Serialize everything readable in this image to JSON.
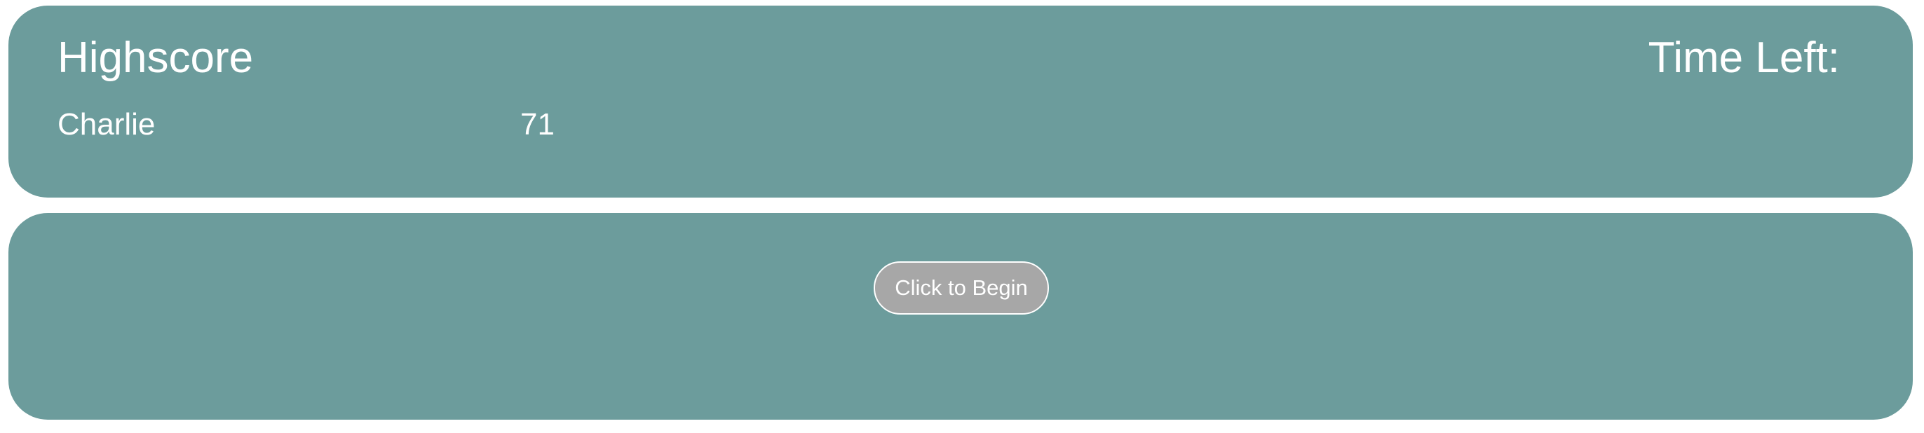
{
  "header": {
    "highscore_title": "Highscore",
    "time_left_label": "Time Left:"
  },
  "highscore": {
    "name": "Charlie",
    "score": "71"
  },
  "game": {
    "start_button_label": "Click to Begin"
  },
  "colors": {
    "panel_background": "#6c9c9c",
    "button_background": "#a7a7a7",
    "text": "#ffffff"
  }
}
